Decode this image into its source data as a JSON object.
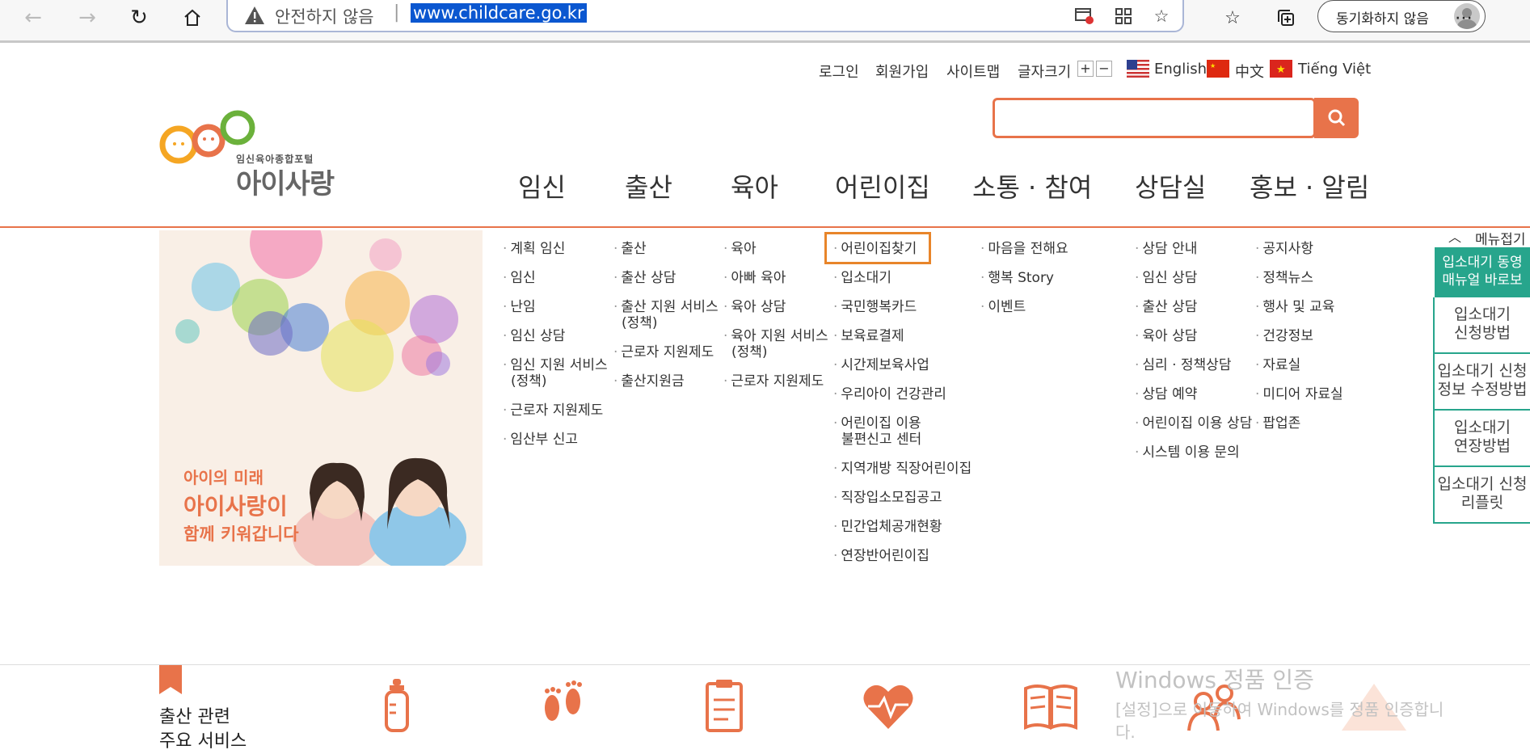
{
  "browser": {
    "insecure_label": "안전하지 않음",
    "separator": "|",
    "url": "www.childcare.go.kr",
    "sync_label": "동기화하지 않음"
  },
  "util": {
    "login": "로그인",
    "join": "회원가입",
    "sitemap": "사이트맵",
    "fontsize": "글자크기",
    "plus": "+",
    "minus": "−",
    "english": "English",
    "chinese": "中文",
    "vietnamese": "Tiếng Việt"
  },
  "logo": {
    "sub": "임신육아종합포털",
    "main": "아이사랑"
  },
  "nav": [
    "임신",
    "출산",
    "육아",
    "어린이집",
    "소통 · 참여",
    "상담실",
    "홍보 · 알림"
  ],
  "banner": {
    "line1": "아이의 미래",
    "line2": "아이사랑이",
    "line3": "함께 키워갑니다"
  },
  "submenus": {
    "pregnancy": [
      "계획 임신",
      "임신",
      "난임",
      "임신 상담",
      "임신 지원 서비스",
      "(정책)",
      "근로자 지원제도",
      "임산부 신고"
    ],
    "birth": [
      "출산",
      "출산 상담",
      "출산 지원 서비스",
      "(정책)",
      "근로자 지원제도",
      "출산지원금"
    ],
    "parenting": [
      "육아",
      "아빠 육아",
      "육아 상담",
      "육아 지원 서비스",
      "(정책)",
      "근로자 지원제도"
    ],
    "daycare": [
      "어린이집찾기",
      "입소대기",
      "국민행복카드",
      "보육료결제",
      "시간제보육사업",
      "우리아이 건강관리",
      "어린이집 이용",
      "불편신고 센터",
      "지역개방 직장어린이집",
      "직장입소모집공고",
      "민간업체공개현황",
      "연장반어린이집"
    ],
    "community": [
      "마음을 전해요",
      "행복 Story",
      "이벤트"
    ],
    "counsel": [
      "상담 안내",
      "임신 상담",
      "출산 상담",
      "육아 상담",
      "심리 · 정책상담",
      "상담 예약",
      "어린이집 이용 상담",
      "시스템 이용 문의"
    ],
    "pr": [
      "공지사항",
      "정책뉴스",
      "행사 및 교육",
      "건강정보",
      "자료실",
      "미디어 자료실",
      "팝업존"
    ]
  },
  "quick": {
    "collapse": "메뉴접기",
    "green1": "입소대기 동영",
    "green2": "매뉴얼 바로보",
    "items": [
      [
        "입소대기",
        "신청방법"
      ],
      [
        "입소대기 신청",
        "정보 수정방법"
      ],
      [
        "입소대기",
        "연장방법"
      ],
      [
        "입소대기 신청",
        "리플릿"
      ]
    ]
  },
  "bottom": {
    "title1": "출산 관련",
    "title2": "주요 서비스"
  },
  "watermark": {
    "line1": "Windows 정품 인증",
    "line2": "[설정]으로 이동하여 Windows를 정품 인증합니",
    "line3": "다."
  },
  "colors": {
    "accent": "#e8734a",
    "green": "#27a58c",
    "highlight": "#e8852a"
  }
}
